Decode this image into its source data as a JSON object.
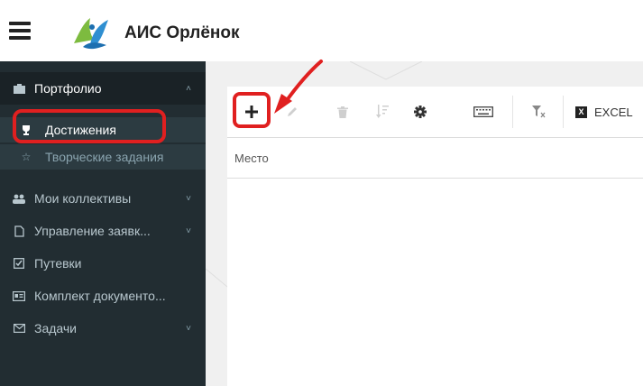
{
  "header": {
    "app_title": "АИС Орлёнок",
    "menu_icon": "hamburger-menu-icon",
    "logo_icon": "orlyonok-logo-icon"
  },
  "sidebar": {
    "items": [
      {
        "label": "Портфолио",
        "icon": "briefcase-icon",
        "expanded": true
      },
      {
        "label": "Мои коллективы",
        "icon": "users-icon"
      },
      {
        "label": "Управление заявк...",
        "icon": "file-icon"
      },
      {
        "label": "Путевки",
        "icon": "checkbox-icon"
      },
      {
        "label": "Комплект документо...",
        "icon": "id-card-icon"
      },
      {
        "label": "Задачи",
        "icon": "envelope-icon"
      }
    ],
    "sub_items": [
      {
        "label": "Достижения",
        "icon": "trophy-icon",
        "selected": true
      },
      {
        "label": "Творческие задания",
        "icon": "star-icon"
      }
    ]
  },
  "toolbar": {
    "excel_label": "EXCEL",
    "excel_icon_text": "X"
  },
  "table": {
    "columns": [
      "Место"
    ]
  },
  "colors": {
    "sidebar_bg": "#222d32",
    "highlight": "#e02020"
  }
}
